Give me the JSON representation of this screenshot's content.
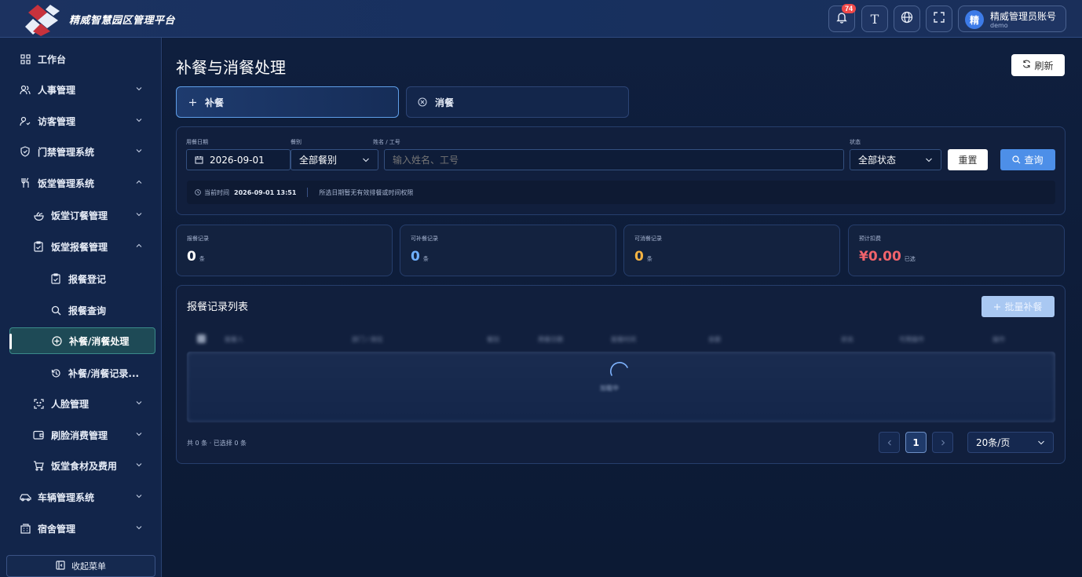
{
  "header": {
    "app_title": "精威智慧园区管理平台",
    "notification_count": "74",
    "font_btn_glyph": "T",
    "user": {
      "avatar_char": "精",
      "name": "精威管理员账号",
      "account": "demo"
    }
  },
  "sidebar": {
    "items": [
      {
        "label": "工作台",
        "icon": "grid-icon"
      },
      {
        "label": "人事管理",
        "icon": "users-icon"
      },
      {
        "label": "访客管理",
        "icon": "visitor-icon"
      },
      {
        "label": "门禁管理系统",
        "icon": "shield-icon"
      },
      {
        "label": "饭堂管理系统",
        "icon": "utensils-icon"
      },
      {
        "label": "饭堂订餐管理",
        "icon": "salad-icon"
      },
      {
        "label": "饭堂报餐管理",
        "icon": "clipboard-icon"
      },
      {
        "label": "报餐登记",
        "icon": "clipboard-check-icon"
      },
      {
        "label": "报餐查询",
        "icon": "search-icon"
      },
      {
        "label": "补餐/消餐处理",
        "icon": "plus-circle-icon"
      },
      {
        "label": "补餐/消餐记录...",
        "icon": "history-icon"
      },
      {
        "label": "人脸管理",
        "icon": "face-scan-icon"
      },
      {
        "label": "刷脸消费管理",
        "icon": "wallet-icon"
      },
      {
        "label": "饭堂食材及费用",
        "icon": "cart-icon"
      },
      {
        "label": "车辆管理系统",
        "icon": "car-icon"
      },
      {
        "label": "宿舍管理",
        "icon": "building-icon"
      }
    ],
    "collapse_label": "收起菜单"
  },
  "page": {
    "title": "补餐与消餐处理",
    "refresh_label": "刷新",
    "tabs": [
      {
        "label": "补餐"
      },
      {
        "label": "消餐"
      }
    ]
  },
  "filters": {
    "date_label": "用餐日期",
    "date_value": "2026-09-01",
    "meal_label": "餐别",
    "meal_value": "全部餐别",
    "name_label": "姓名 / 工号",
    "name_placeholder": "输入姓名、工号",
    "status_label": "状态",
    "status_value": "全部状态",
    "reset_label": "重置",
    "query_label": "查询"
  },
  "info": {
    "time_label": "当前时间",
    "time_value": "2026-09-01 13:51",
    "notice": "所选日期暂无有效排餐或时间权限"
  },
  "stats": [
    {
      "label": "报餐记录",
      "value": "0",
      "unit": "条",
      "color": "#ffffff"
    },
    {
      "label": "可补餐记录",
      "value": "0",
      "unit": "条",
      "color": "#6fb0ff"
    },
    {
      "label": "可消餐记录",
      "value": "0",
      "unit": "条",
      "color": "#f5b342"
    },
    {
      "label": "预计扣费",
      "value": "¥0.00",
      "unit": "已选",
      "color": "#f0636b"
    }
  ],
  "records": {
    "title": "报餐记录列表",
    "batch_label": "批量补餐",
    "columns": [
      "报餐人",
      "部门 / 岗位",
      "餐别",
      "用餐日期",
      "报餐时间",
      "金额",
      "状态",
      "可用操作",
      "操作"
    ],
    "loading_text": "加载中",
    "summary": "共 0 条 · 已选择 0 条",
    "current_page": "1",
    "page_size": "20条/页"
  }
}
